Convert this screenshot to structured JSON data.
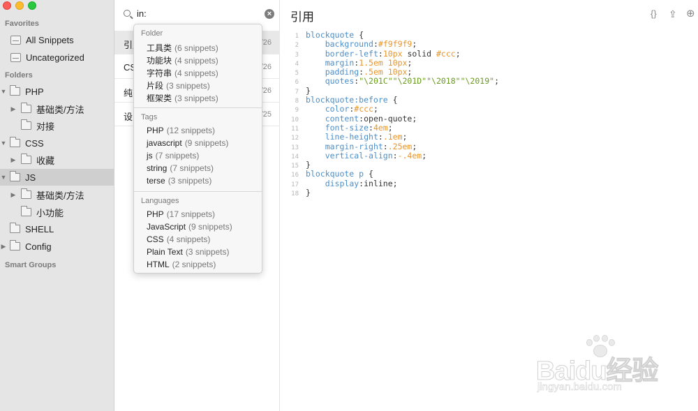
{
  "sidebar": {
    "favorites_header": "Favorites",
    "favorites": [
      {
        "label": "All Snippets",
        "selected": false
      },
      {
        "label": "Uncategorized",
        "selected": false
      }
    ],
    "folders_header": "Folders",
    "folders": [
      {
        "label": "PHP",
        "expanded": true
      },
      {
        "label": "基础类/方法"
      },
      {
        "label": "对接"
      },
      {
        "label": "CSS",
        "expanded": true
      },
      {
        "label": "收藏"
      },
      {
        "label": "JS",
        "expanded": true,
        "selected": true
      },
      {
        "label": "基础类/方法"
      },
      {
        "label": "小功能"
      },
      {
        "label": "SHELL"
      },
      {
        "label": "Config"
      }
    ],
    "smart_groups_header": "Smart Groups"
  },
  "search": {
    "value": "in:",
    "clear_icon": "×"
  },
  "snippets": [
    {
      "title": "引用",
      "date": "/26",
      "selected": true
    },
    {
      "title": "CS",
      "date": "/26"
    },
    {
      "title": "纯",
      "date": "/26"
    },
    {
      "title": "设",
      "date": "/25"
    }
  ],
  "dropdown": {
    "folder_header": "Folder",
    "folders": [
      {
        "name": "工具类",
        "count": "(6 snippets)"
      },
      {
        "name": "功能块",
        "count": "(4 snippets)"
      },
      {
        "name": "字符串",
        "count": "(4 snippets)"
      },
      {
        "name": "片段",
        "count": "(3 snippets)"
      },
      {
        "name": "框架类",
        "count": "(3 snippets)"
      }
    ],
    "tags_header": "Tags",
    "tags": [
      {
        "name": "PHP",
        "count": "(12 snippets)"
      },
      {
        "name": "javascript",
        "count": "(9 snippets)"
      },
      {
        "name": "js",
        "count": "(7 snippets)"
      },
      {
        "name": "string",
        "count": "(7 snippets)"
      },
      {
        "name": "terse",
        "count": "(3 snippets)"
      }
    ],
    "languages_header": "Languages",
    "languages": [
      {
        "name": "PHP",
        "count": "(17 snippets)"
      },
      {
        "name": "JavaScript",
        "count": "(9 snippets)"
      },
      {
        "name": "CSS",
        "count": "(4 snippets)"
      },
      {
        "name": "Plain Text",
        "count": "(3 snippets)"
      },
      {
        "name": "HTML",
        "count": "(2 snippets)"
      }
    ]
  },
  "editor": {
    "title": "引用",
    "toolbar": {
      "braces_icon": "{}",
      "share_icon": "⇪",
      "add_icon": "⊕"
    },
    "code_lines": [
      {
        "n": "1",
        "parts": [
          [
            "sel",
            "blockquote"
          ],
          [
            "pl",
            " {"
          ]
        ]
      },
      {
        "n": "2",
        "parts": [
          [
            "pl",
            "    "
          ],
          [
            "prop",
            "background"
          ],
          [
            "pl",
            ":"
          ],
          [
            "hex",
            "#f9f9f9"
          ],
          [
            "pl",
            ";"
          ]
        ]
      },
      {
        "n": "3",
        "parts": [
          [
            "pl",
            "    "
          ],
          [
            "prop",
            "border-left"
          ],
          [
            "pl",
            ":"
          ],
          [
            "num",
            "10px"
          ],
          [
            "pl",
            " solid "
          ],
          [
            "hex",
            "#ccc"
          ],
          [
            "pl",
            ";"
          ]
        ]
      },
      {
        "n": "4",
        "parts": [
          [
            "pl",
            "    "
          ],
          [
            "prop",
            "margin"
          ],
          [
            "pl",
            ":"
          ],
          [
            "num",
            "1.5em 10px"
          ],
          [
            "pl",
            ";"
          ]
        ]
      },
      {
        "n": "5",
        "parts": [
          [
            "pl",
            "    "
          ],
          [
            "prop",
            "padding"
          ],
          [
            "pl",
            ":"
          ],
          [
            "num",
            ".5em 10px"
          ],
          [
            "pl",
            ";"
          ]
        ]
      },
      {
        "n": "6",
        "parts": [
          [
            "pl",
            "    "
          ],
          [
            "prop",
            "quotes"
          ],
          [
            "pl",
            ":"
          ],
          [
            "str",
            "\"\\201C\"\"\\201D\"\"\\2018\"\"\\2019\""
          ],
          [
            "pl",
            ";"
          ]
        ]
      },
      {
        "n": "7",
        "parts": [
          [
            "pl",
            "}"
          ]
        ]
      },
      {
        "n": "8",
        "parts": [
          [
            "sel",
            "blockquote:before"
          ],
          [
            "pl",
            " {"
          ]
        ]
      },
      {
        "n": "9",
        "parts": [
          [
            "pl",
            "    "
          ],
          [
            "prop",
            "color"
          ],
          [
            "pl",
            ":"
          ],
          [
            "hex",
            "#ccc"
          ],
          [
            "pl",
            ";"
          ]
        ]
      },
      {
        "n": "10",
        "parts": [
          [
            "pl",
            "    "
          ],
          [
            "prop",
            "content"
          ],
          [
            "pl",
            ":open-quote;"
          ]
        ]
      },
      {
        "n": "11",
        "parts": [
          [
            "pl",
            "    "
          ],
          [
            "prop",
            "font-size"
          ],
          [
            "pl",
            ":"
          ],
          [
            "num",
            "4em"
          ],
          [
            "pl",
            ";"
          ]
        ]
      },
      {
        "n": "12",
        "parts": [
          [
            "pl",
            "    "
          ],
          [
            "prop",
            "line-height"
          ],
          [
            "pl",
            ":"
          ],
          [
            "num",
            ".1em"
          ],
          [
            "pl",
            ";"
          ]
        ]
      },
      {
        "n": "13",
        "parts": [
          [
            "pl",
            "    "
          ],
          [
            "prop",
            "margin-right"
          ],
          [
            "pl",
            ":"
          ],
          [
            "num",
            ".25em"
          ],
          [
            "pl",
            ";"
          ]
        ]
      },
      {
        "n": "14",
        "parts": [
          [
            "pl",
            "    "
          ],
          [
            "prop",
            "vertical-align"
          ],
          [
            "pl",
            ":"
          ],
          [
            "num",
            "-.4em"
          ],
          [
            "pl",
            ";"
          ]
        ]
      },
      {
        "n": "15",
        "parts": [
          [
            "pl",
            "}"
          ]
        ]
      },
      {
        "n": "16",
        "parts": [
          [
            "sel",
            "blockquote p"
          ],
          [
            "pl",
            " {"
          ]
        ]
      },
      {
        "n": "17",
        "parts": [
          [
            "pl",
            "    "
          ],
          [
            "prop",
            "display"
          ],
          [
            "pl",
            ":inline;"
          ]
        ]
      },
      {
        "n": "18",
        "parts": [
          [
            "pl",
            "}"
          ]
        ]
      }
    ]
  },
  "watermark": {
    "brand": "Baidu经验",
    "url": "jingyan.baidu.com"
  }
}
